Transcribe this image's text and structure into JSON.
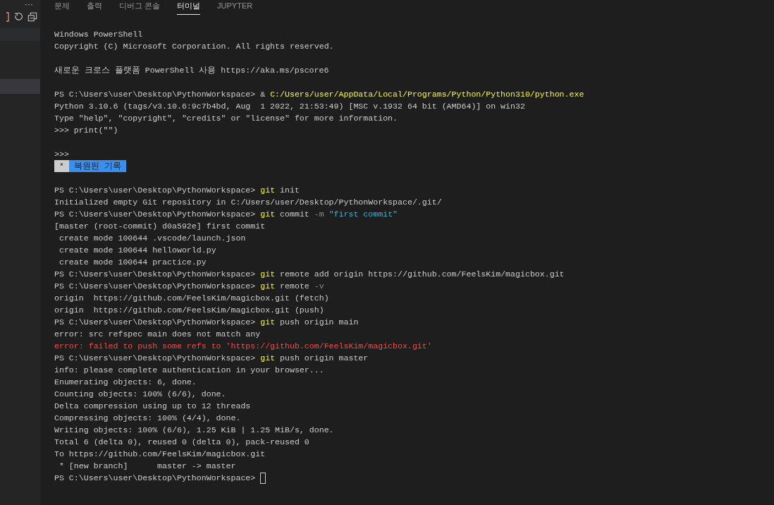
{
  "sidebar": {
    "more_button": "···",
    "rows": [
      {
        "kind": "hover"
      },
      {
        "kind": "selected"
      }
    ]
  },
  "panel_tabs": [
    {
      "label": "문제",
      "selected": false
    },
    {
      "label": "출력",
      "selected": false
    },
    {
      "label": "디버그 콘솔",
      "selected": false
    },
    {
      "label": "터미널",
      "selected": true
    },
    {
      "label": "JUPYTER",
      "selected": false
    }
  ],
  "terminal": {
    "blocks": [
      [
        [
          {
            "kind": "plain",
            "text": "Windows PowerShell"
          }
        ],
        [
          {
            "kind": "plain",
            "text": "Copyright (C) Microsoft Corporation. All rights reserved."
          }
        ]
      ],
      [
        [
          {
            "kind": "plain",
            "text": "새로운 크로스 플랫폼 PowerShell 사용 https://aka.ms/pscore6"
          }
        ]
      ],
      [
        [
          {
            "kind": "plain",
            "text": "PS C:\\Users\\user\\Desktop\\PythonWorkspace> & "
          },
          {
            "kind": "command",
            "text": "C:/Users/user/AppData/Local/Programs/Python/Python310/python.exe"
          }
        ],
        [
          {
            "kind": "plain",
            "text": "Python 3.10.6 (tags/v3.10.6:9c7b4bd, Aug  1 2022, 21:53:49) [MSC v.1932 64 bit (AMD64)] on win32"
          }
        ],
        [
          {
            "kind": "plain",
            "text": "Type \"help\", \"copyright\", \"credits\" or \"license\" for more information."
          }
        ],
        [
          {
            "kind": "plain",
            "text": ">>> print(\"\")"
          }
        ]
      ],
      [
        [
          {
            "kind": "plain",
            "text": ">>>"
          }
        ],
        [
          {
            "kind": "badge",
            "text": " * "
          },
          {
            "kind": "banner",
            "text": " 복원된 기록 "
          }
        ]
      ],
      [
        [
          {
            "kind": "plain",
            "text": "PS C:\\Users\\user\\Desktop\\PythonWorkspace> "
          },
          {
            "kind": "command",
            "text": "git"
          },
          {
            "kind": "plain",
            "text": " init"
          }
        ],
        [
          {
            "kind": "plain",
            "text": "Initialized empty Git repository in C:/Users/user/Desktop/PythonWorkspace/.git/"
          }
        ],
        [
          {
            "kind": "plain",
            "text": "PS C:\\Users\\user\\Desktop\\PythonWorkspace> "
          },
          {
            "kind": "command",
            "text": "git"
          },
          {
            "kind": "plain",
            "text": " commit "
          },
          {
            "kind": "flag",
            "text": "-m"
          },
          {
            "kind": "string",
            "text": " \"first commit\""
          }
        ],
        [
          {
            "kind": "plain",
            "text": "[master (root-commit) d0a592e] first commit"
          }
        ],
        [
          {
            "kind": "plain",
            "text": " create mode 100644 .vscode/launch.json"
          }
        ],
        [
          {
            "kind": "plain",
            "text": " create mode 100644 helloworld.py"
          }
        ],
        [
          {
            "kind": "plain",
            "text": " create mode 100644 practice.py"
          }
        ],
        [
          {
            "kind": "plain",
            "text": "PS C:\\Users\\user\\Desktop\\PythonWorkspace> "
          },
          {
            "kind": "command",
            "text": "git"
          },
          {
            "kind": "plain",
            "text": " remote add origin https://github.com/FeelsKim/magicbox.git"
          }
        ],
        [
          {
            "kind": "plain",
            "text": "PS C:\\Users\\user\\Desktop\\PythonWorkspace> "
          },
          {
            "kind": "command",
            "text": "git"
          },
          {
            "kind": "plain",
            "text": " remote "
          },
          {
            "kind": "flag",
            "text": "-v"
          }
        ],
        [
          {
            "kind": "plain",
            "text": "origin  https://github.com/FeelsKim/magicbox.git (fetch)"
          }
        ],
        [
          {
            "kind": "plain",
            "text": "origin  https://github.com/FeelsKim/magicbox.git (push)"
          }
        ],
        [
          {
            "kind": "plain",
            "text": "PS C:\\Users\\user\\Desktop\\PythonWorkspace> "
          },
          {
            "kind": "command",
            "text": "git"
          },
          {
            "kind": "plain",
            "text": " push origin main"
          }
        ],
        [
          {
            "kind": "plain",
            "text": "error: src refspec main does not match any"
          }
        ],
        [
          {
            "kind": "error",
            "text": "error: failed to push some refs to 'https://github.com/FeelsKim/magicbox.git'"
          }
        ],
        [
          {
            "kind": "plain",
            "text": "PS C:\\Users\\user\\Desktop\\PythonWorkspace> "
          },
          {
            "kind": "command",
            "text": "git"
          },
          {
            "kind": "plain",
            "text": " push origin master"
          }
        ],
        [
          {
            "kind": "plain",
            "text": "info: please complete authentication in your browser..."
          }
        ],
        [
          {
            "kind": "plain",
            "text": "Enumerating objects: 6, done."
          }
        ],
        [
          {
            "kind": "plain",
            "text": "Counting objects: 100% (6/6), done."
          }
        ],
        [
          {
            "kind": "plain",
            "text": "Delta compression using up to 12 threads"
          }
        ],
        [
          {
            "kind": "plain",
            "text": "Compressing objects: 100% (4/4), done."
          }
        ],
        [
          {
            "kind": "plain",
            "text": "Writing objects: 100% (6/6), 1.25 KiB | 1.25 MiB/s, done."
          }
        ],
        [
          {
            "kind": "plain",
            "text": "Total 6 (delta 0), reused 0 (delta 0), pack-reused 0"
          }
        ],
        [
          {
            "kind": "plain",
            "text": "To https://github.com/FeelsKim/magicbox.git"
          }
        ],
        [
          {
            "kind": "plain",
            "text": " * [new branch]      master -> master"
          }
        ],
        [
          {
            "kind": "plain",
            "text": "PS C:\\Users\\user\\Desktop\\PythonWorkspace> "
          },
          {
            "kind": "cursor"
          }
        ]
      ]
    ]
  }
}
